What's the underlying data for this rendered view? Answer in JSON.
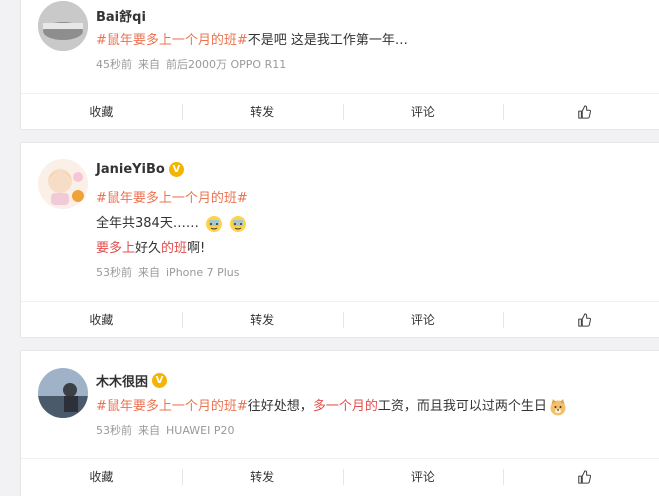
{
  "posts": [
    {
      "username": "Bai舒qi",
      "verified": false,
      "tag": "#鼠年要多上一个月的班#",
      "text_after_tag": "不是吧 这是我工作第一年…",
      "time": "45秒前",
      "source_prefix": "来自",
      "source": "前后2000万 OPPO R11"
    },
    {
      "username": "JanieYiBo",
      "verified": true,
      "tag": "#鼠年要多上一个月的班#",
      "line2": "全年共384天……",
      "line3_parts": [
        {
          "text": "要多上",
          "hl": true
        },
        {
          "text": "好久",
          "hl": false
        },
        {
          "text": "的班",
          "hl": true
        },
        {
          "text": "啊!",
          "hl": false
        }
      ],
      "time": "53秒前",
      "source_prefix": "来自",
      "source": "iPhone 7 Plus"
    },
    {
      "username": "木木很困",
      "verified": true,
      "tag": "#鼠年要多上一个月的班#",
      "text_parts": [
        {
          "text": "往好处想，",
          "hl": false
        },
        {
          "text": "多一个月的",
          "hl": true
        },
        {
          "text": "工资，而且我可以过两个生日",
          "hl": false
        }
      ],
      "time": "53秒前",
      "source_prefix": "来自",
      "source": "HUAWEI P20"
    }
  ],
  "actions": {
    "favorite": "收藏",
    "repost": "转发",
    "comment": "评论"
  },
  "colors": {
    "tag": "#eb7350",
    "highlight": "#e24e4e",
    "verified": "#f5b400"
  }
}
